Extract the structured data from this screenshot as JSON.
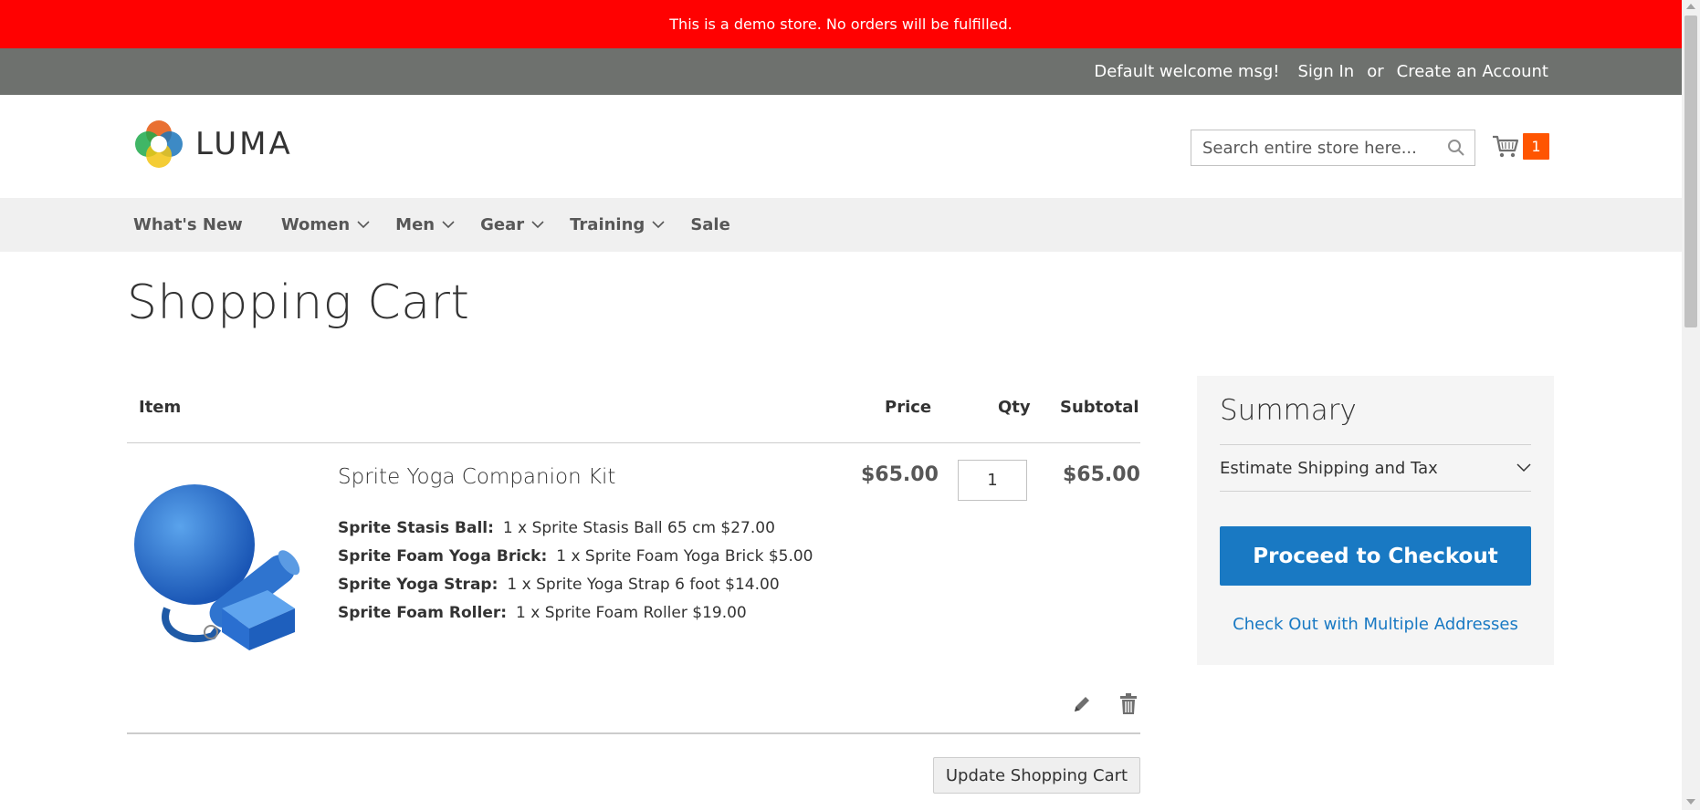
{
  "demo_notice": "This is a demo store. No orders will be fulfilled.",
  "top_links": {
    "welcome": "Default welcome msg!",
    "sign_in": "Sign In",
    "or": "or",
    "create_account": "Create an Account"
  },
  "header": {
    "logo_text": "LUMA",
    "search_placeholder": "Search entire store here...",
    "cart_count": "1"
  },
  "nav": {
    "items": [
      {
        "label": "What's New",
        "has_submenu": false
      },
      {
        "label": "Women",
        "has_submenu": true
      },
      {
        "label": "Men",
        "has_submenu": true
      },
      {
        "label": "Gear",
        "has_submenu": true
      },
      {
        "label": "Training",
        "has_submenu": true
      },
      {
        "label": "Sale",
        "has_submenu": false
      }
    ]
  },
  "page_title": "Shopping Cart",
  "cart": {
    "headers": {
      "item": "Item",
      "price": "Price",
      "qty": "Qty",
      "subtotal": "Subtotal"
    },
    "items": [
      {
        "name": "Sprite Yoga Companion Kit",
        "price": "$65.00",
        "qty": "1",
        "subtotal": "$65.00",
        "options": [
          {
            "label": "Sprite Stasis Ball:",
            "value": "1 x Sprite Stasis Ball 65 cm $27.00"
          },
          {
            "label": "Sprite Foam Yoga Brick:",
            "value": "1 x Sprite Foam Yoga Brick $5.00"
          },
          {
            "label": "Sprite Yoga Strap:",
            "value": "1 x Sprite Yoga Strap 6 foot $14.00"
          },
          {
            "label": "Sprite Foam Roller:",
            "value": "1 x Sprite Foam Roller $19.00"
          }
        ]
      }
    ],
    "update_button": "Update Shopping Cart"
  },
  "summary": {
    "title": "Summary",
    "estimate_label": "Estimate Shipping and Tax",
    "checkout_button": "Proceed to Checkout",
    "multi_address_link": "Check Out with Multiple Addresses"
  },
  "colors": {
    "demo_bar": "#ff0101",
    "top_bar": "#6e716e",
    "accent_blue": "#1979c3",
    "cart_badge": "#ff5501"
  }
}
